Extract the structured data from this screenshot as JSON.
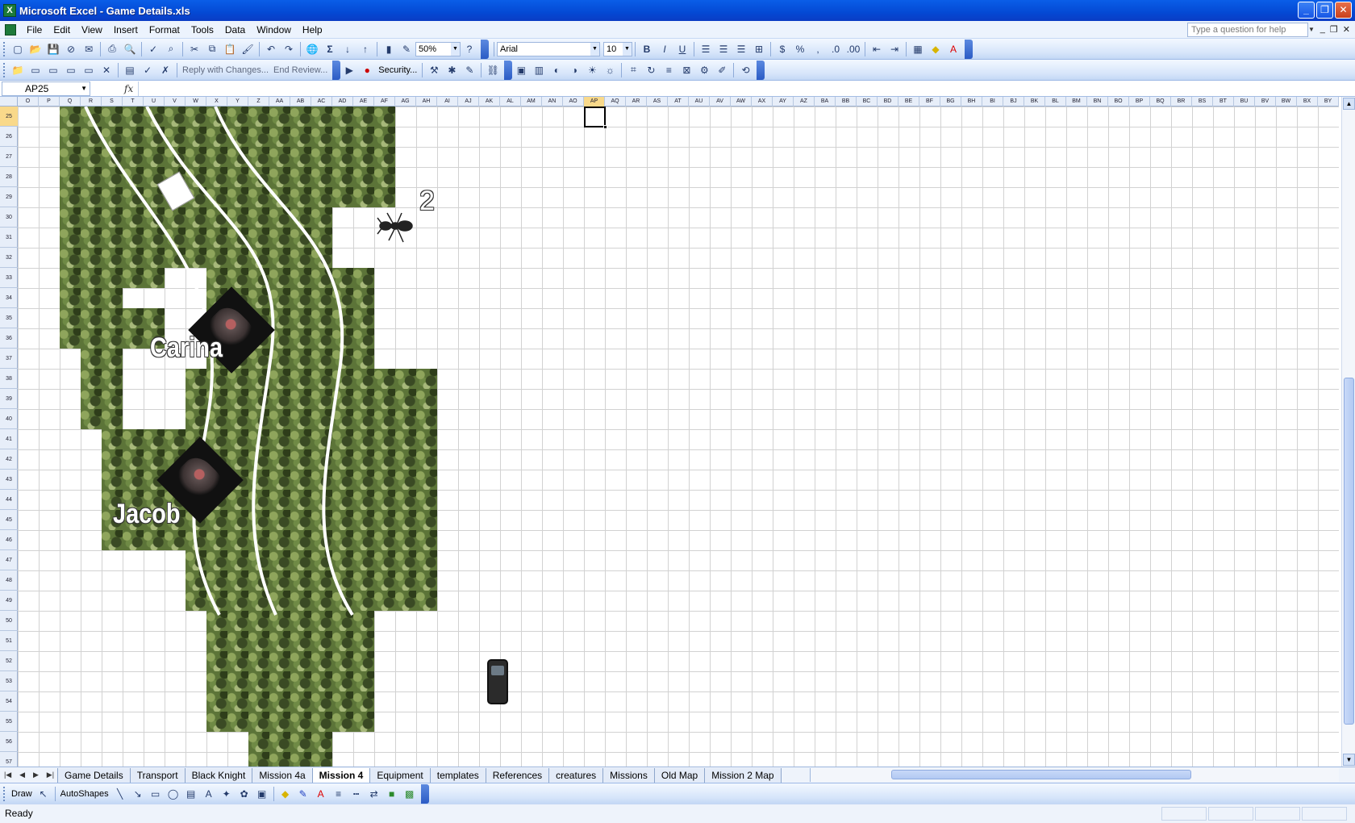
{
  "window": {
    "title": "Microsoft Excel - Game Details.xls",
    "app_icon": "X"
  },
  "menu": {
    "items": [
      "File",
      "Edit",
      "View",
      "Insert",
      "Format",
      "Tools",
      "Data",
      "Window",
      "Help"
    ],
    "help_placeholder": "Type a question for help"
  },
  "standard_toolbar": {
    "zoom": "50%",
    "font_name": "Arial",
    "font_size": "10"
  },
  "reviewing_toolbar": {
    "reply_label": "Reply with Changes...",
    "end_review_label": "End Review...",
    "security_label": "Security..."
  },
  "formula_bar": {
    "name_box": "AP25",
    "fx": "fx",
    "formula": ""
  },
  "columns": [
    "O",
    "P",
    "Q",
    "R",
    "S",
    "T",
    "U",
    "V",
    "W",
    "X",
    "Y",
    "Z",
    "AA",
    "AB",
    "AC",
    "AD",
    "AE",
    "AF",
    "AG",
    "AH",
    "AI",
    "AJ",
    "AK",
    "AL",
    "AM",
    "AN",
    "AO",
    "AP",
    "AQ",
    "AR",
    "AS",
    "AT",
    "AU",
    "AV",
    "AW",
    "AX",
    "AY",
    "AZ",
    "BA",
    "BB",
    "BC",
    "BD",
    "BE",
    "BF",
    "BG",
    "BH",
    "BI",
    "BJ",
    "BK",
    "BL",
    "BM",
    "BN",
    "BO",
    "BP",
    "BQ",
    "BR",
    "BS",
    "BT",
    "BU",
    "BV",
    "BW",
    "BX",
    "BY"
  ],
  "active_column": "AP",
  "rows": [
    "25",
    "26",
    "27",
    "28",
    "29",
    "30",
    "31",
    "32",
    "33",
    "34",
    "35",
    "36",
    "37",
    "38",
    "39",
    "40",
    "41",
    "42",
    "43",
    "44",
    "45",
    "46",
    "47",
    "48",
    "49",
    "50",
    "51",
    "52",
    "53",
    "54",
    "55",
    "56",
    "57"
  ],
  "active_row": "25",
  "map": {
    "labels": {
      "carina": "Carina",
      "jacob": "Jacob",
      "ant_number": "2"
    }
  },
  "sheet_tabs": [
    "Game Details",
    "Transport",
    "Black Knight",
    "Mission 4a",
    "Mission 4",
    "Equipment",
    "templates",
    "References",
    "creatures",
    "Missions",
    "Old Map",
    "Mission 2 Map"
  ],
  "active_tab": "Mission 4",
  "drawing_toolbar": {
    "draw_label": "Draw",
    "autoshapes_label": "AutoShapes"
  },
  "status": {
    "text": "Ready"
  },
  "colors": {
    "title_bar": "#0a5ee8",
    "camo": "#5c7438",
    "active_header": "#f9d98a"
  }
}
